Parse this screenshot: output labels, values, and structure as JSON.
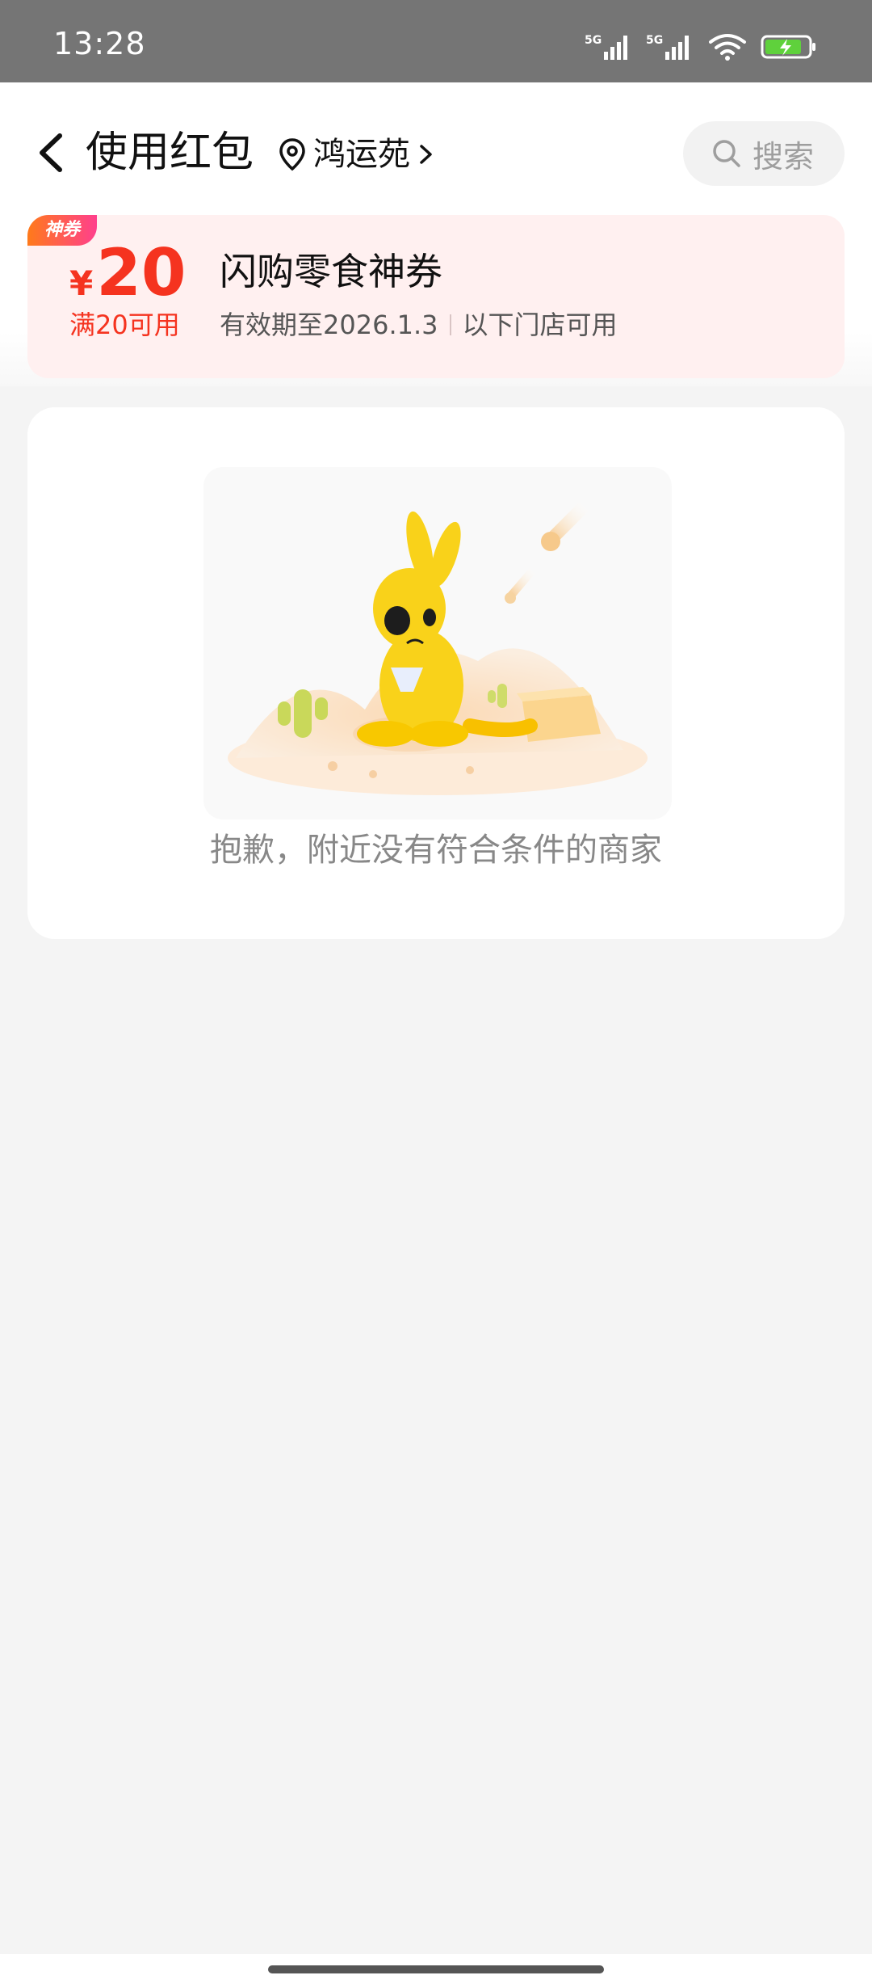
{
  "status_bar": {
    "time": "13:28",
    "signal_1_label": "5G",
    "signal_2_label": "5G",
    "icons": [
      "signal-icon",
      "signal-icon",
      "wifi-icon",
      "battery-charging-icon"
    ]
  },
  "header": {
    "title": "使用红包",
    "location": "鸿运苑",
    "search_placeholder": "搜索"
  },
  "coupon": {
    "tag": "神券",
    "currency": "¥",
    "amount": "20",
    "threshold": "满20可用",
    "name": "闪购零食神券",
    "validity": "有效期至2026.1.3",
    "scope": "以下门店可用",
    "accent_color": "#f5331f",
    "background_color": "#fff0f0"
  },
  "empty_state": {
    "message": "抱歉，附近没有符合条件的商家",
    "illustration": "kangaroo-desert-illustration"
  }
}
